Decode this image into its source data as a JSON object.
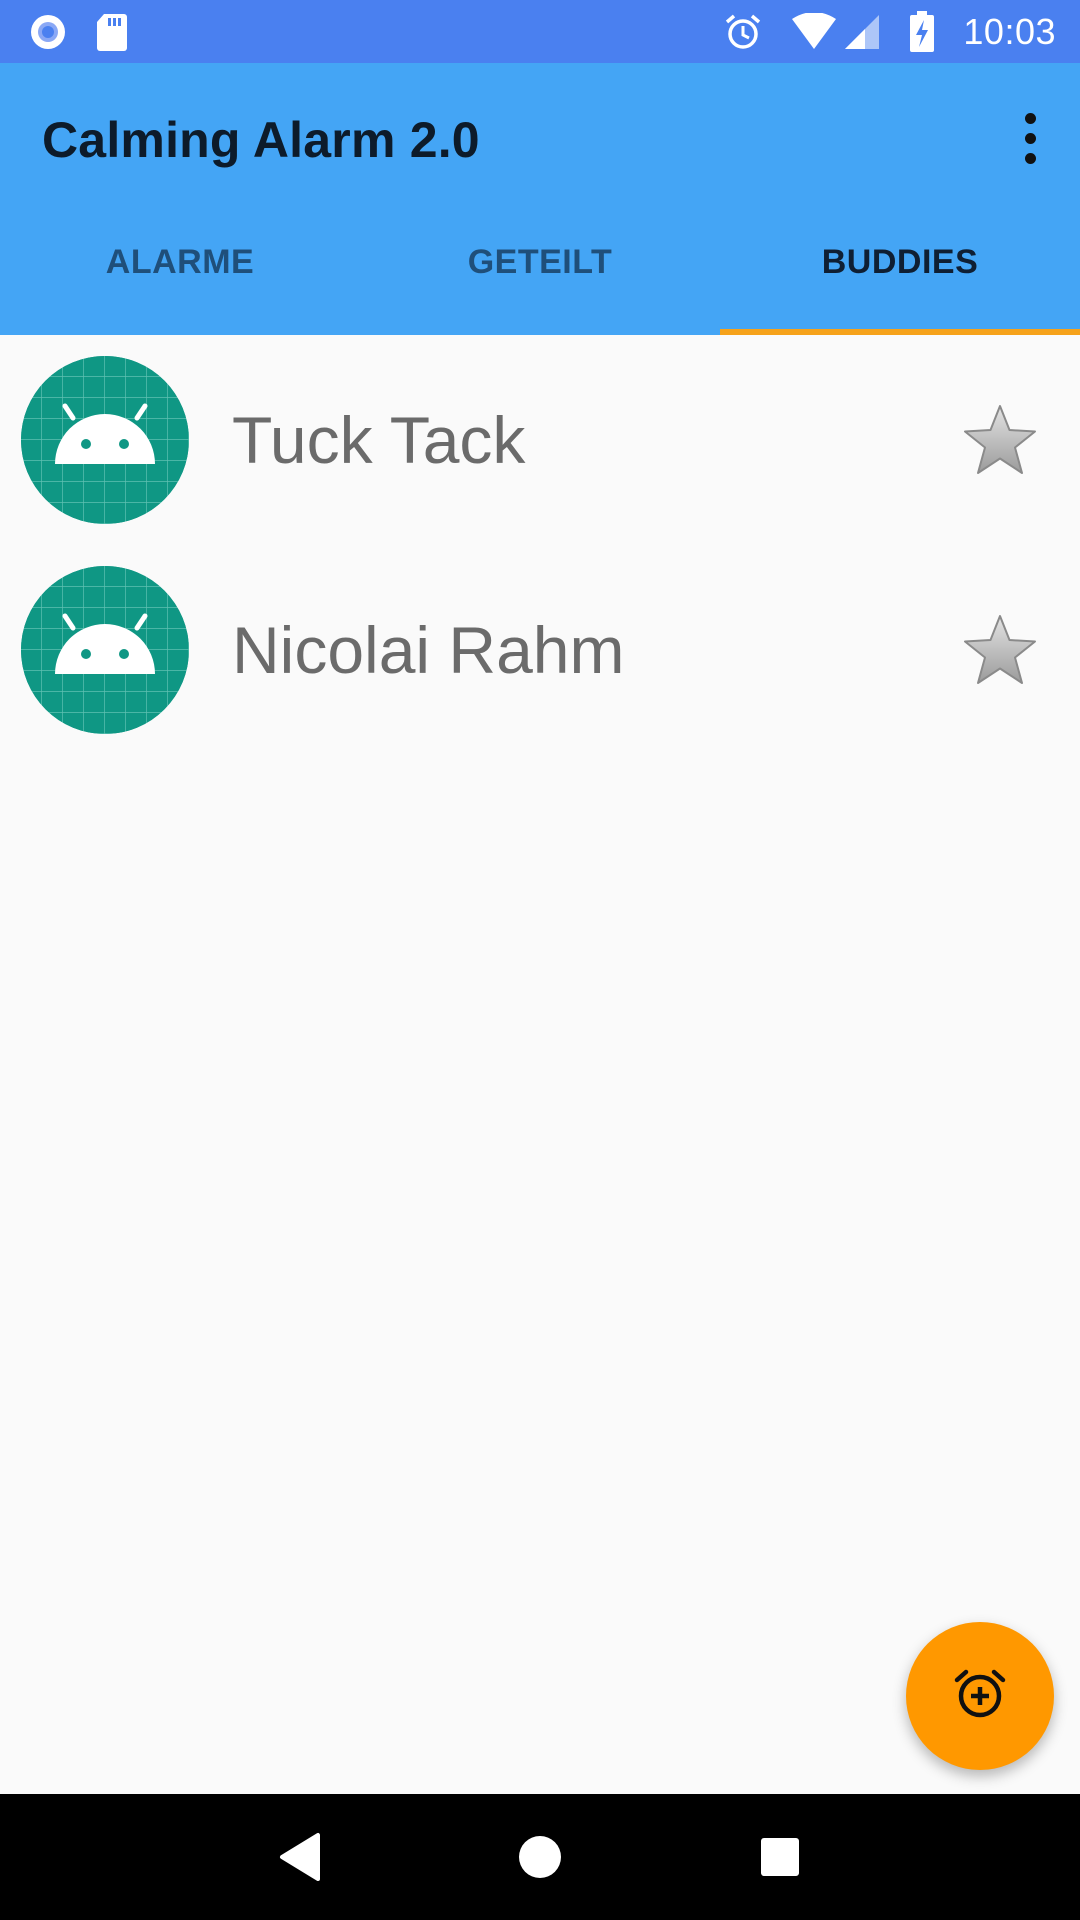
{
  "status_bar": {
    "time": "10:03",
    "left_icons": [
      "record-indicator-icon",
      "sd-card-icon"
    ],
    "right_icons": [
      "alarm-clock-icon",
      "wifi-icon",
      "cell-signal-icon",
      "battery-charging-icon"
    ]
  },
  "app_bar": {
    "title": "Calming Alarm 2.0",
    "menu_icon": "more-vertical-icon"
  },
  "tabs": [
    {
      "label": "ALARME",
      "active": false
    },
    {
      "label": "GETEILT",
      "active": false
    },
    {
      "label": "BUDDIES",
      "active": true
    }
  ],
  "buddies": [
    {
      "name": "Tuck Tack",
      "avatar_icon": "android-avatar-icon",
      "favorite_icon": "star-icon"
    },
    {
      "name": "Nicolai Rahm",
      "avatar_icon": "android-avatar-icon",
      "favorite_icon": "star-icon"
    }
  ],
  "fab": {
    "icon": "add-alarm-icon"
  },
  "nav_bar": {
    "icons": [
      "back-icon",
      "home-icon",
      "recents-icon"
    ]
  },
  "colors": {
    "status_bar": "#4a80f0",
    "app_bar": "#44a5f5",
    "tab_indicator": "#f6a21a",
    "avatar": "#0f9784",
    "fab": "#ff9800",
    "background": "#fafafa"
  }
}
